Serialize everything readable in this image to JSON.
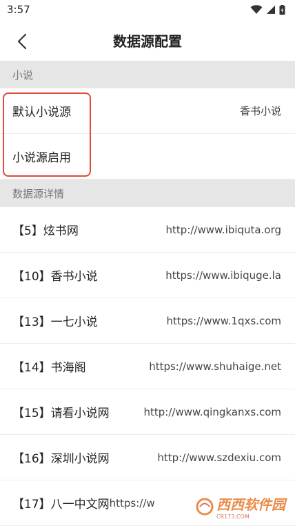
{
  "status_bar": {
    "time": "3:57"
  },
  "header": {
    "title": "数据源配置"
  },
  "section_novel": {
    "label": "小说"
  },
  "settings": [
    {
      "label": "默认小说源",
      "value": "香书小说"
    },
    {
      "label": "小说源启用",
      "value": ""
    }
  ],
  "section_details": {
    "label": "数据源详情"
  },
  "sources": [
    {
      "name": "【5】炫书网",
      "url": "http://www.ibiquta.org"
    },
    {
      "name": "【10】香书小说",
      "url": "https://www.ibiquge.la"
    },
    {
      "name": "【13】一七小说",
      "url": "https://www.1qxs.com"
    },
    {
      "name": "【14】书海阁",
      "url": "https://www.shuhaige.net"
    },
    {
      "name": "【15】请看小说网",
      "url": "http://www.qingkanxs.com"
    },
    {
      "name": "【16】深圳小说网",
      "url": "http://www.szdexiu.com"
    },
    {
      "name": "【17】八一中文网",
      "url": "https://w"
    }
  ],
  "watermark": {
    "brand": "西西软件园",
    "domain": "CR173.COM"
  },
  "colors": {
    "highlight": "#e04a3a",
    "section_bg": "#e6e6e6"
  }
}
